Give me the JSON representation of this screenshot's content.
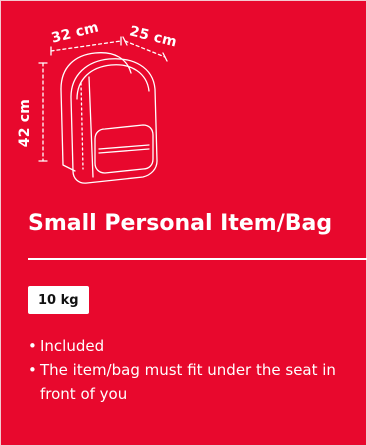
{
  "bag": {
    "dimensions": {
      "width": "32 cm",
      "depth": "25 cm",
      "height": "42 cm"
    },
    "title": "Small Personal Item/Bag",
    "weight_badge": "10 kg",
    "features": [
      "Included",
      "The item/bag must fit under the seat in front of you"
    ],
    "bullet": "•"
  },
  "colors": {
    "card_background": "#e8082d",
    "foreground": "#ffffff",
    "badge_text": "#111111"
  },
  "icons": {
    "illustration": "backpack-icon"
  }
}
